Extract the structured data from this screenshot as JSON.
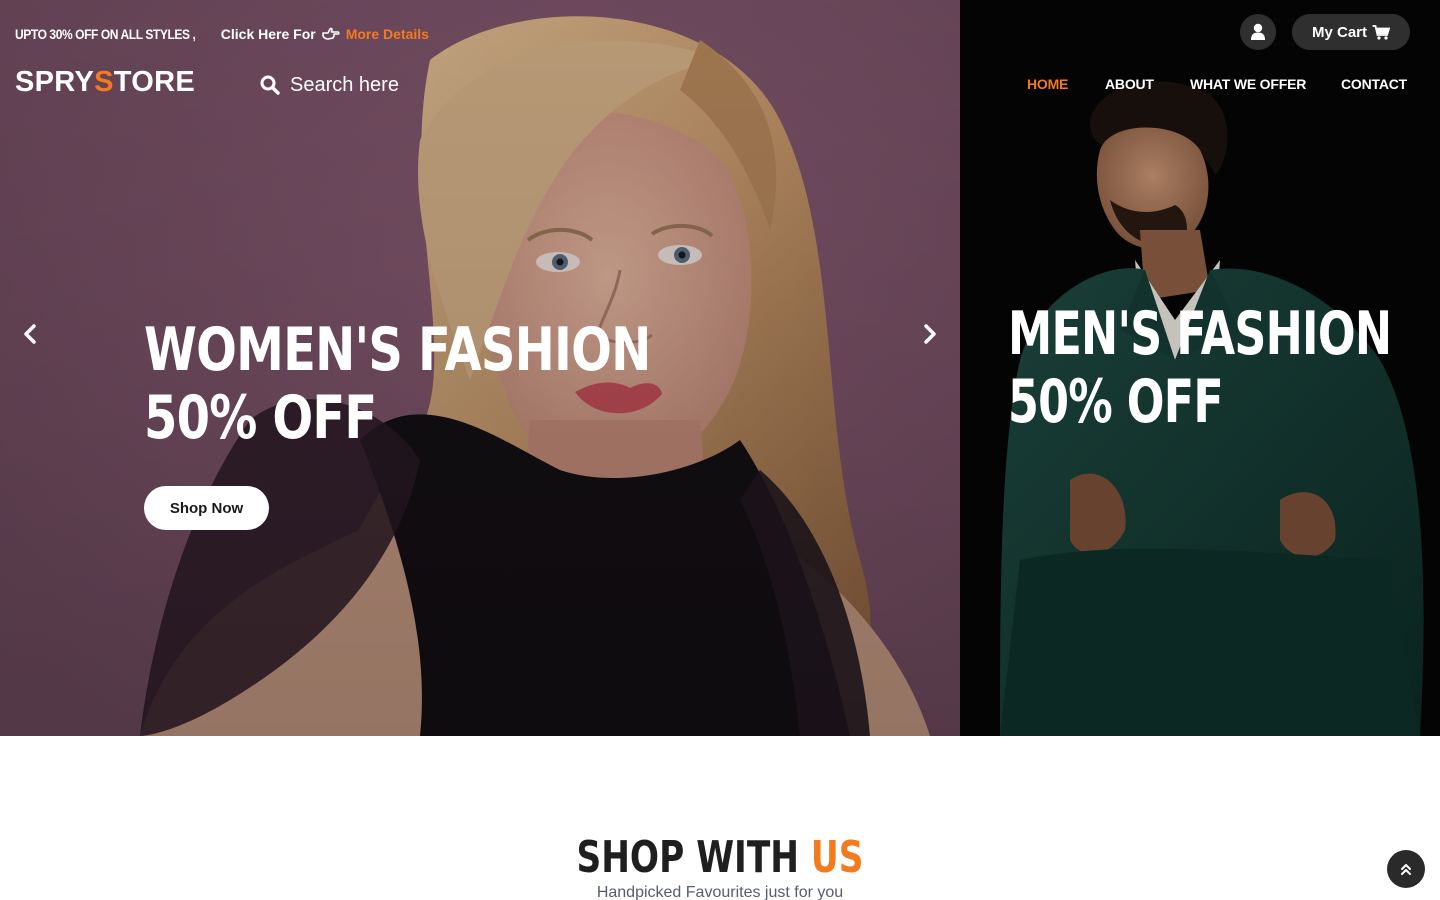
{
  "topbar": {
    "promo_text": "UPTO 30% OFF ON ALL STYLES ,",
    "click_text": "Click Here For",
    "more_link": "More Details"
  },
  "brand": {
    "logo_part1": "SPRY",
    "logo_s": "S",
    "logo_part2": "TORE"
  },
  "search": {
    "placeholder": "Search here"
  },
  "account": {
    "cart_label": "My Cart"
  },
  "nav": {
    "items": [
      {
        "label": "HOME",
        "active": true
      },
      {
        "label": "ABOUT",
        "active": false
      },
      {
        "label": "WHAT WE OFFER",
        "active": false
      },
      {
        "label": "CONTACT",
        "active": false
      }
    ]
  },
  "hero": {
    "women_line1": "WOMEN'S FASHION",
    "women_line2": "50% OFF",
    "women_button": "Shop Now",
    "men_line1": "MEN'S FASHION",
    "men_line2": "50% OFF"
  },
  "section": {
    "title_main": "SHOP WITH",
    "title_accent": "US",
    "subtitle": "Handpicked Favourites just for you"
  },
  "icons": {
    "search": "search-icon",
    "user": "user-icon",
    "cart": "cart-icon",
    "hand": "hand-point-right-icon",
    "prev": "chevron-left-icon",
    "next": "chevron-right-icon",
    "top": "double-chevron-up-icon"
  },
  "colors": {
    "accent": "#f47a20",
    "button_dark": "#2f2f2f"
  }
}
